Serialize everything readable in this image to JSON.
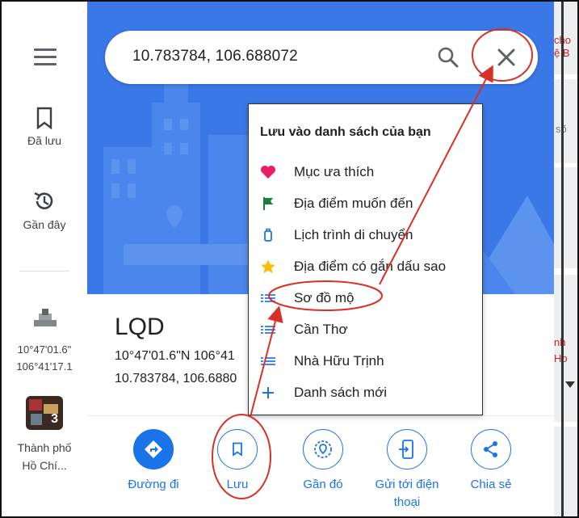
{
  "search": {
    "query": "10.783784, 106.688072"
  },
  "rail": {
    "saved_label": "Đã lưu",
    "recent_label": "Gần đây",
    "coord_line1": "10°47'01.6\"",
    "coord_line2": "106°41'17.1",
    "city_line1": "Thành phố",
    "city_line2": "Hồ Chí...",
    "thumb_badge": "3"
  },
  "place": {
    "title": "LQD",
    "dms": "10°47'01.6\"N 106°41",
    "decimal": "10.783784, 106.6880"
  },
  "actions": [
    {
      "label": "Đường đi",
      "icon": "directions-icon"
    },
    {
      "label": "Lưu",
      "icon": "bookmark-icon"
    },
    {
      "label": "Gần đó",
      "icon": "nearby-icon"
    },
    {
      "label_line1": "Gửi tới điện",
      "label_line2": "thoại",
      "icon": "send-to-phone-icon"
    },
    {
      "label": "Chia sẻ",
      "icon": "share-icon"
    }
  ],
  "save_menu": {
    "heading": "Lưu vào danh sách của bạn",
    "items": [
      {
        "label": "Mục ưa thích",
        "icon": "heart-icon",
        "color": "#e91e63"
      },
      {
        "label": "Địa điểm muốn đến",
        "icon": "flag-icon",
        "color": "#188038"
      },
      {
        "label": "Lịch trình di chuyển",
        "icon": "luggage-icon",
        "color": "#1a73e8"
      },
      {
        "label": "Địa điểm có gắn dấu sao",
        "icon": "star-icon",
        "color": "#fbbc04"
      },
      {
        "label": "Sơ đồ mộ",
        "icon": "list-icon",
        "color": "#4285f4"
      },
      {
        "label": "Cần Thơ",
        "icon": "list-icon",
        "color": "#4285f4"
      },
      {
        "label": "Nhà Hữu Trịnh",
        "icon": "list-icon",
        "color": "#4285f4"
      },
      {
        "label": "Danh sách mới",
        "icon": "plus-icon",
        "color": "#1a73e8"
      }
    ]
  },
  "map_strip": {
    "t1": "cho",
    "t2": "ệ B",
    "t3": "sõ",
    "t4": "nh",
    "t5": "Ho"
  },
  "colors": {
    "accent": "#1a73e8",
    "hero": "#3b78e7",
    "annotation": "#d93025"
  }
}
